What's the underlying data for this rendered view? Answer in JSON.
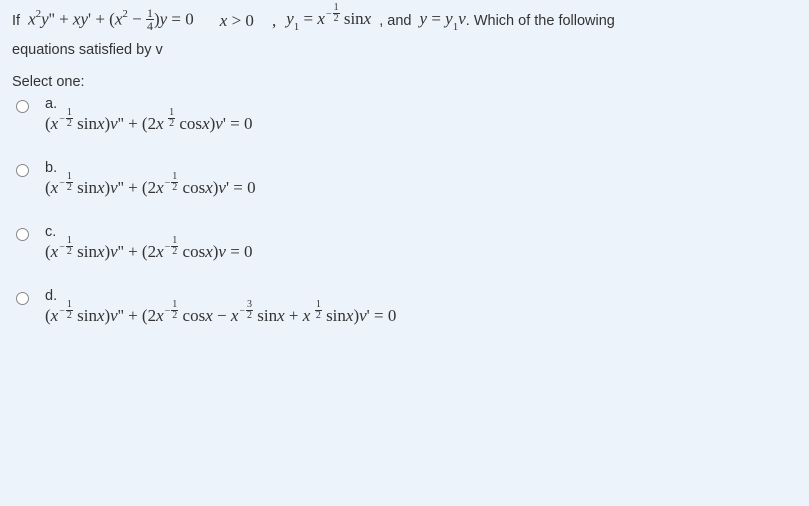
{
  "question": {
    "prefix": "If",
    "eq_main": "x^{2}y'' + xy' + (x^{2} - 1/4)y = 0",
    "cond1": "x > 0",
    "comma": ",",
    "y1_expr": "y_{1} = x^{-1/2} sinx",
    "and_text": ", and",
    "y_expr": "y = y_{1}v",
    "tail": ". Which of the following",
    "line2": "equations satisfied by v"
  },
  "select_one": "Select one:",
  "options": {
    "a": {
      "label": "a.",
      "eq": "(x^{-1/2} sinx)v'' + (2x^{1/2} cosx)v' = 0"
    },
    "b": {
      "label": "b.",
      "eq": "(x^{-1/2} sinx)v'' + (2x^{-1/2} cosx)v' = 0"
    },
    "c": {
      "label": "c.",
      "eq": "(x^{-1/2} sinx)v'' + (2x^{-1/2} cosx)v = 0"
    },
    "d": {
      "label": "d.",
      "eq": "(x^{-1/2} sinx)v'' + (2x^{-1/2} cosx - x^{-3/2} sinx + x^{1/2} sinx)v' = 0"
    }
  },
  "chart_data": null
}
